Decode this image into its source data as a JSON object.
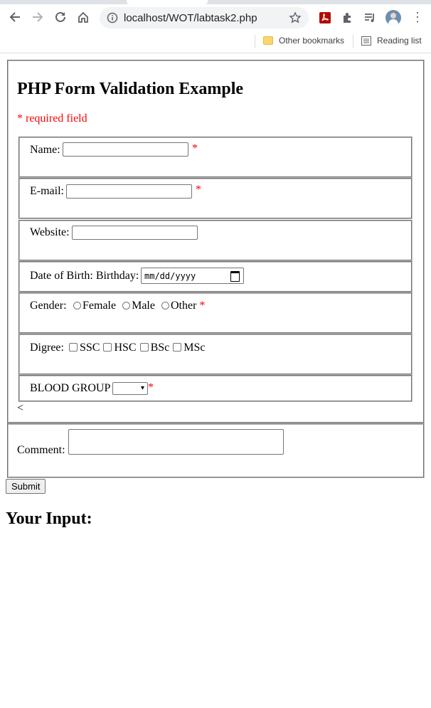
{
  "browser": {
    "url": "localhost/WOT/labtask2.php",
    "bookmarks": {
      "other": "Other bookmarks",
      "reading_list": "Reading list"
    }
  },
  "form": {
    "title": "PHP Form Validation Example",
    "required_note": "* required field",
    "name_label": "Name:",
    "email_label": "E-mail:",
    "website_label": "Website:",
    "dob_label": "Date of Birth: Birthday:",
    "dob_placeholder": "mm/dd/yyyy",
    "gender_label": "Gender:",
    "gender_options": [
      "Female",
      "Male",
      "Other"
    ],
    "degree_label": "Digree:",
    "degree_options": [
      "SSC",
      "HSC",
      "BSc",
      "MSc"
    ],
    "blood_group_label": "BLOOD GROUP",
    "required_mark": "*",
    "stray_char": "<",
    "comment_label": "Comment:",
    "submit_label": "Submit"
  },
  "output": {
    "heading": "Your Input:"
  }
}
